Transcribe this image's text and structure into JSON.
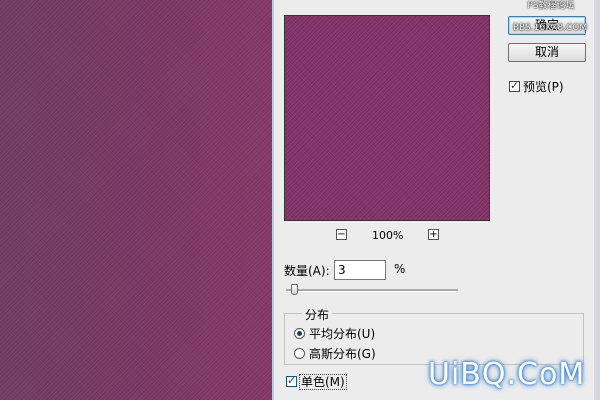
{
  "watermark": {
    "top_line": "PS教程论坛",
    "mid_line": "BBS.16XX8.COM"
  },
  "buttons": {
    "ok": "确定",
    "cancel": "取消"
  },
  "preview": {
    "label": "预览(P)",
    "checked": true
  },
  "zoom": {
    "minus": "−",
    "level": "100%",
    "plus": "+"
  },
  "amount": {
    "label": "数量(A):",
    "value": "3",
    "unit": "%",
    "slider_fraction": 0.03
  },
  "distribution": {
    "title": "分布",
    "options": [
      {
        "label": "平均分布(U)",
        "selected": true
      },
      {
        "label": "高斯分布(G)",
        "selected": false
      }
    ]
  },
  "monochromatic": {
    "label": "单色(M)",
    "checked": true
  },
  "brand": "UiBQ.CoM",
  "colors": {
    "canvas": "#7a3463",
    "preview": "#822f66",
    "dialog": "#ececec",
    "brand_glow": "#3a8be0"
  }
}
